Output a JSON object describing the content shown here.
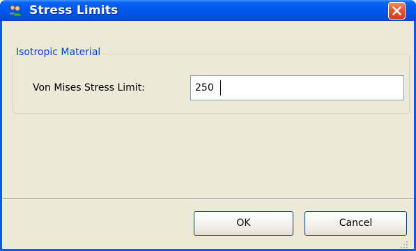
{
  "window": {
    "title": "Stress Limits",
    "icon": "users-icon",
    "close_icon": "close-icon"
  },
  "group": {
    "legend": "Isotropic Material",
    "field_label": "Von Mises Stress Limit:",
    "field_value": "250"
  },
  "buttons": {
    "ok": "OK",
    "cancel": "Cancel"
  },
  "colors": {
    "titlebar": "#0058ee",
    "client": "#ece9d8",
    "legend_text": "#0046d5",
    "close_button": "#e2572f"
  }
}
